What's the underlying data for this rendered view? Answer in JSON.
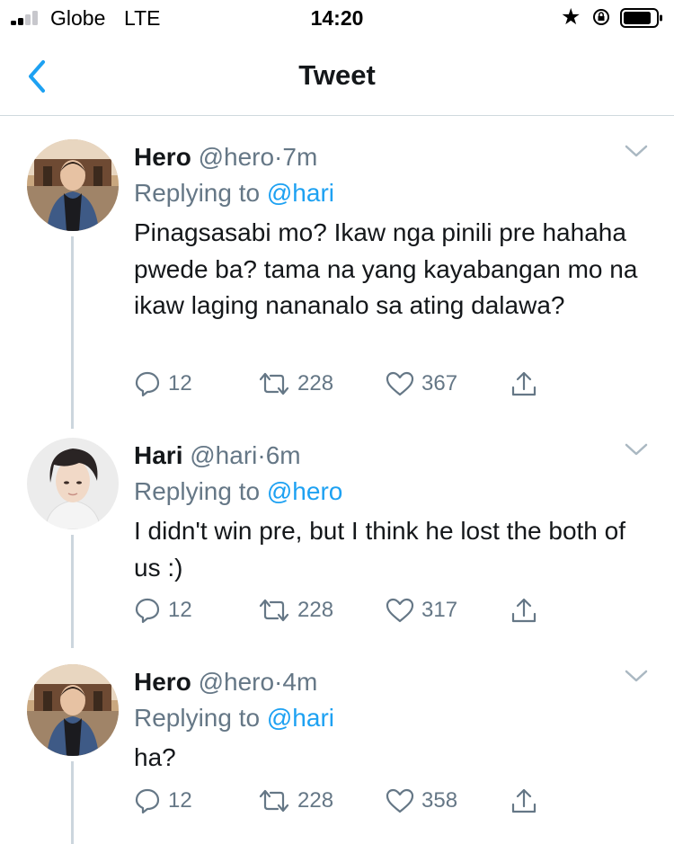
{
  "status_bar": {
    "carrier": "Globe",
    "network": "LTE",
    "time": "14:20"
  },
  "header": {
    "title": "Tweet"
  },
  "tweets": [
    {
      "name": "Hero",
      "handle": "@hero",
      "separator": "·",
      "time": "7m",
      "replying_prefix": "Replying to",
      "replying_to": "@hari",
      "text": "Pinagsasabi mo? Ikaw nga pinili pre hahaha pwede ba? tama na yang kayabangan mo na ikaw laging nananalo sa ating dalawa?",
      "replies": "12",
      "retweets": "228",
      "likes": "367"
    },
    {
      "name": "Hari",
      "handle": "@hari",
      "separator": "·",
      "time": "6m",
      "replying_prefix": "Replying to",
      "replying_to": "@hero",
      "text": "I didn't win pre, but I think he lost the both of us :)",
      "replies": "12",
      "retweets": "228",
      "likes": "317"
    },
    {
      "name": "Hero",
      "handle": "@hero",
      "separator": "·",
      "time": "4m",
      "replying_prefix": "Replying to",
      "replying_to": "@hari",
      "text": "ha?",
      "replies": "12",
      "retweets": "228",
      "likes": "358"
    }
  ],
  "icons": {
    "back": "chevron-left-icon",
    "more": "chevron-down-icon",
    "reply": "speech-bubble-icon",
    "retweet": "retweet-icon",
    "like": "heart-icon",
    "share": "share-icon"
  },
  "colors": {
    "accent": "#1da1f2",
    "secondary_text": "#657786",
    "primary_text": "#14171a",
    "divider": "#cfd9de"
  }
}
